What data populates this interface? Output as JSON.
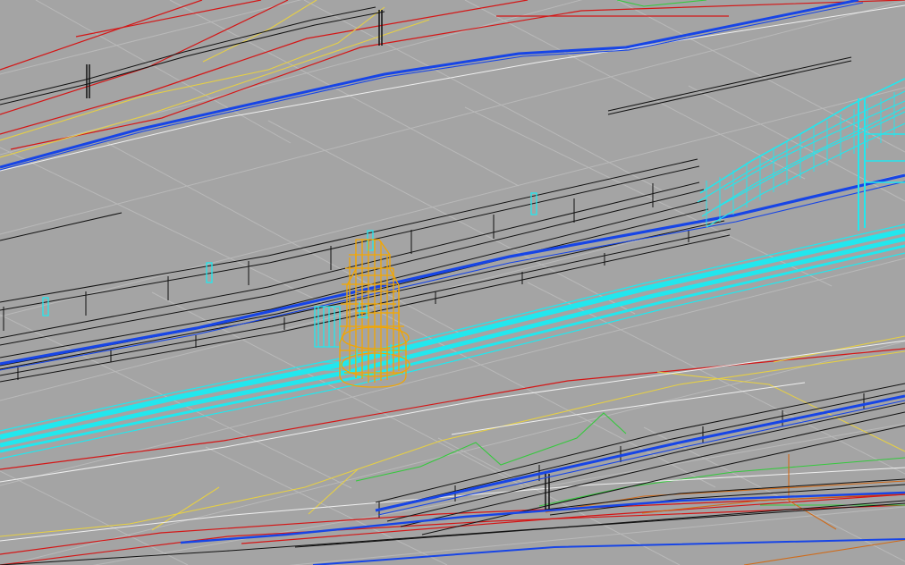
{
  "viewport": {
    "background_color": "#a4a4a4",
    "palette": {
      "grid": "#b9b9b9",
      "black_edges": "#111111",
      "blue_tracks": "#1745e6",
      "cyan_surface": "#22e7ee",
      "orange_column": "#f3a600",
      "red_lines": "#d41616",
      "yellow_lines": "#e6cf44",
      "green_lines": "#35c93d",
      "white_lines": "#f0f0f0",
      "brown_lines": "#cf6b1a"
    }
  }
}
